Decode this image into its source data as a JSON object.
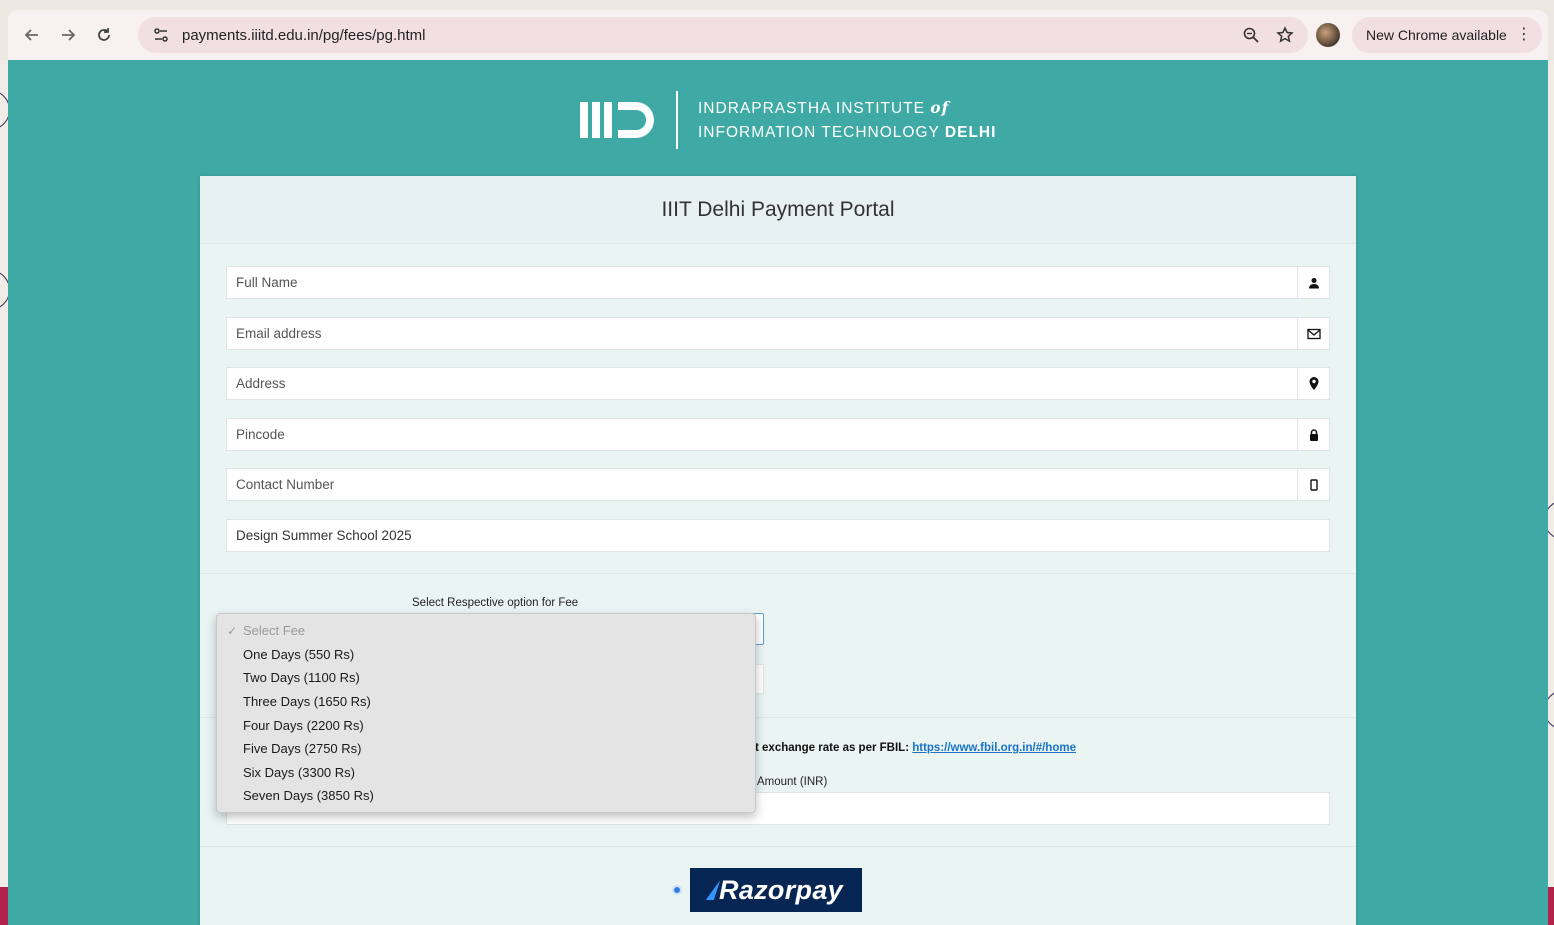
{
  "browser": {
    "url": "payments.iiitd.edu.in/pg/fees/pg.html",
    "update_label": "New Chrome available"
  },
  "header": {
    "line1_prefix": "INDRAPRASTHA INSTITUTE ",
    "line1_italic": "of",
    "line2_prefix": "INFORMATION TECHNOLOGY ",
    "line2_bold": "DELHI"
  },
  "card": {
    "title": "IIIT Delhi Payment Portal"
  },
  "form": {
    "full_name_placeholder": "Full Name",
    "email_placeholder": "Email address",
    "address_placeholder": "Address",
    "pincode_placeholder": "Pincode",
    "contact_placeholder": "Contact Number",
    "program_value": "Design Summer School 2025",
    "fee_label": "Select Respective option for Fee",
    "fbil_text": "t exchange rate as per FBIL: ",
    "fbil_link": "https://www.fbil.org.in/#/home",
    "amount_label": "Amount (INR)"
  },
  "fee_dropdown": {
    "placeholder": "Select Fee",
    "options": [
      "One Days (550 Rs)",
      "Two Days (1100 Rs)",
      "Three Days (1650 Rs)",
      "Four Days (2200 Rs)",
      "Five Days (2750 Rs)",
      "Six Days (3300 Rs)",
      "Seven Days (3850 Rs)"
    ]
  },
  "payment": {
    "provider": "Razorpay"
  },
  "colors": {
    "page_bg": "#3ea9a5",
    "card_bg": "#eaf4f3",
    "link": "#1a73c8",
    "razorpay_bg": "#072654"
  },
  "icons": {
    "full_name": "user-icon",
    "email": "envelope-icon",
    "address": "map-pin-icon",
    "pincode": "lock-icon",
    "contact": "mobile-icon"
  }
}
